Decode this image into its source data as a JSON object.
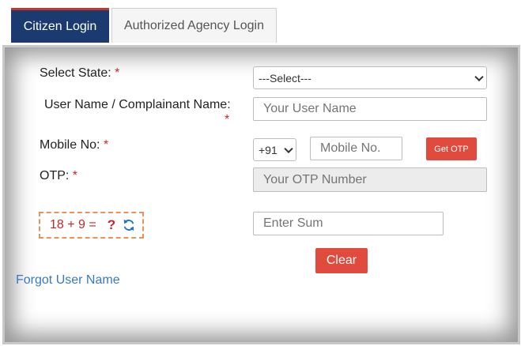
{
  "tabs": {
    "citizen": "Citizen Login",
    "agency": "Authorized Agency Login"
  },
  "form": {
    "state_label": "Select State:",
    "state_selected": "---Select---",
    "username_label": "User Name / Complainant Name:",
    "username_placeholder": "Your User Name",
    "mobile_label": "Mobile No:",
    "country_code": "+91",
    "mobile_placeholder": "Mobile No.",
    "get_otp": "Get OTP",
    "otp_label": "OTP:",
    "otp_placeholder": "Your OTP Number",
    "required_mark": "*"
  },
  "captcha": {
    "expression": "18 + 9 =",
    "unknown": "?",
    "sum_placeholder": "Enter Sum"
  },
  "actions": {
    "clear": "Clear",
    "forgot_username": "Forgot User Name"
  },
  "colors": {
    "tab_active_bg": "#1b3a70",
    "tab_active_border": "#c0392b",
    "button_red": "#e04b3d",
    "required": "#c62828",
    "link": "#3a78c2",
    "captcha_border": "#e8935a",
    "refresh_icon": "#1e73c8"
  }
}
